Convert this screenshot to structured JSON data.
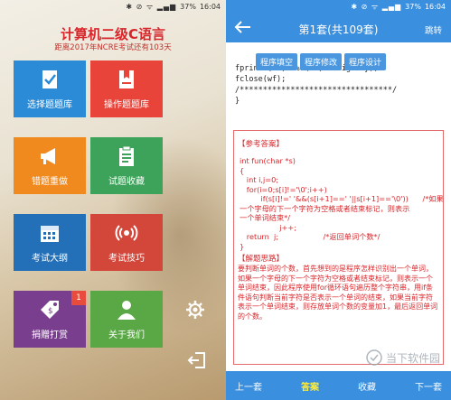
{
  "status_left": {
    "icons": "✱ ⊘ ᯤ ▂▄▆",
    "battery": "37%",
    "time": "16:04"
  },
  "status_right": {
    "icons": "✱ ⊘ ᯤ ▂▄▆",
    "battery": "37%",
    "time": "16:04"
  },
  "home": {
    "title": "计算机二级C语言",
    "subtitle": "距离2017年NCRE考试还有103天",
    "tiles": [
      {
        "label": "选择题题库",
        "color": "#2b8bd6",
        "icon": "check-book-icon"
      },
      {
        "label": "操作题题库",
        "color": "#e8443a",
        "icon": "bookmark-book-icon"
      },
      {
        "label": "错题重做",
        "color": "#f08a1f",
        "icon": "megaphone-icon"
      },
      {
        "label": "试题收藏",
        "color": "#3da35a",
        "icon": "clipboard-icon"
      },
      {
        "label": "考试大纲",
        "color": "#2470b8",
        "icon": "calendar-icon"
      },
      {
        "label": "考试技巧",
        "color": "#d3463a",
        "icon": "broadcast-icon"
      },
      {
        "label": "捐赠打赏",
        "color": "#7a3e8e",
        "icon": "price-tag-icon",
        "badge": "1"
      },
      {
        "label": "关于我们",
        "color": "#5aa845",
        "icon": "person-icon"
      }
    ]
  },
  "detail": {
    "title": "第1套(共109套)",
    "jump": "跳转",
    "tabs": [
      "程序填空",
      "程序修改",
      "程序设计"
    ],
    "code_top": [
      "  fprintf(wf, \"%d\\n\", a*big*cry);",
      "  fclose(wf);",
      "/*********************************/",
      "}"
    ],
    "answer_head": "【参考答案】",
    "code": [
      "int fun(char *s)",
      "{",
      "   int i,j=0;",
      "   for(i=0;s[i]!='\\0';i++)",
      "         if(s[i]!=' '&&(s[i+1]==' '||s[i+1]=='\\0'))      /*如果",
      "一个字母的下一个字符为空格或者结束标记，则表示",
      "一个单词结束*/",
      "                 j++;",
      "   return  j;                   /*返回单词个数*/",
      "}"
    ],
    "analysis_head": "【解题思路】",
    "analysis": "要判断单词的个数，首先想到的是程序怎样识别出一个单词，如果一个字母的下一个字符为空格或者结束标记，则表示一个单词结束，因此程序使用for循环语句遍历整个字符串，用if条件语句判断当前字符是否表示一个单词的结束，如果当前字符表示一个单词结束，则存放单词个数的变量加1，最后返回单词的个数。",
    "bottom": {
      "prev": "上一套",
      "answer": "答案",
      "favorite": "收藏",
      "next": "下一套"
    },
    "watermark": "当下软件园"
  }
}
